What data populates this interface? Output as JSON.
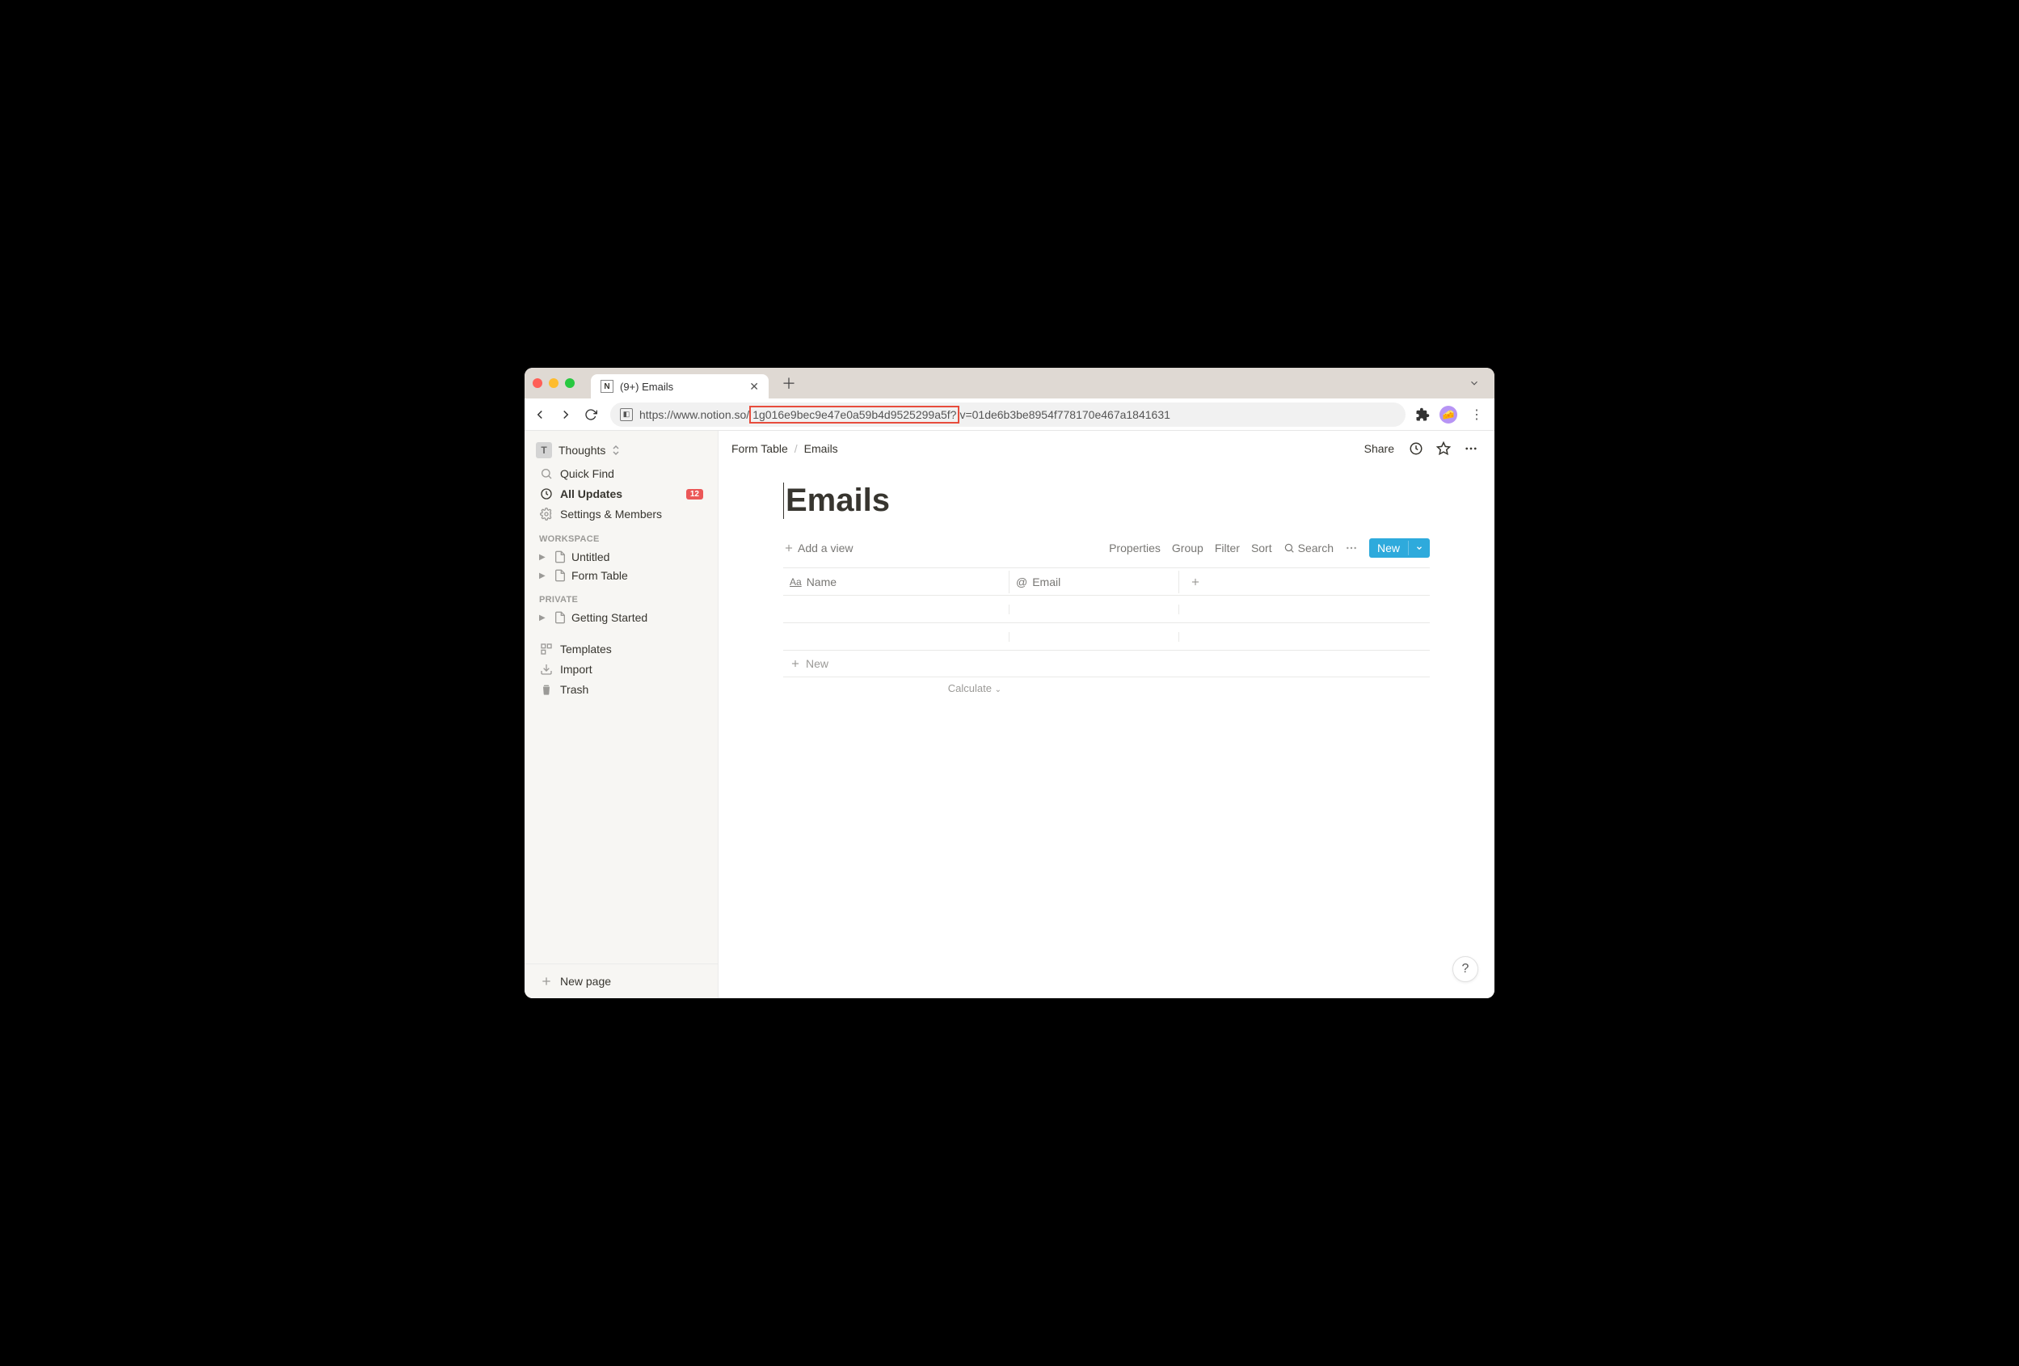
{
  "browser": {
    "tab_title": "(9+) Emails",
    "url_prefix": "https://www.notion.so/",
    "url_highlighted": "1g016e9bec9e47e0a59b4d9525299a5f?",
    "url_suffix": "v=01de6b3be8954f778170e467a1841631"
  },
  "sidebar": {
    "workspace_name": "Thoughts",
    "quick_find": "Quick Find",
    "all_updates": "All Updates",
    "updates_badge": "12",
    "settings": "Settings & Members",
    "section_workspace": "WORKSPACE",
    "section_private": "PRIVATE",
    "pages_workspace": [
      {
        "label": "Untitled"
      },
      {
        "label": "Form Table"
      }
    ],
    "pages_private": [
      {
        "label": "Getting Started"
      }
    ],
    "templates": "Templates",
    "import": "Import",
    "trash": "Trash",
    "new_page": "New page"
  },
  "topbar": {
    "breadcrumb": [
      "Form Table",
      "Emails"
    ],
    "share": "Share"
  },
  "page": {
    "title": "Emails",
    "add_view": "Add a view",
    "toolbar": {
      "properties": "Properties",
      "group": "Group",
      "filter": "Filter",
      "sort": "Sort",
      "search": "Search",
      "new": "New"
    },
    "columns": {
      "name": "Name",
      "email": "Email"
    },
    "new_row": "New",
    "calculate": "Calculate"
  },
  "help": "?"
}
